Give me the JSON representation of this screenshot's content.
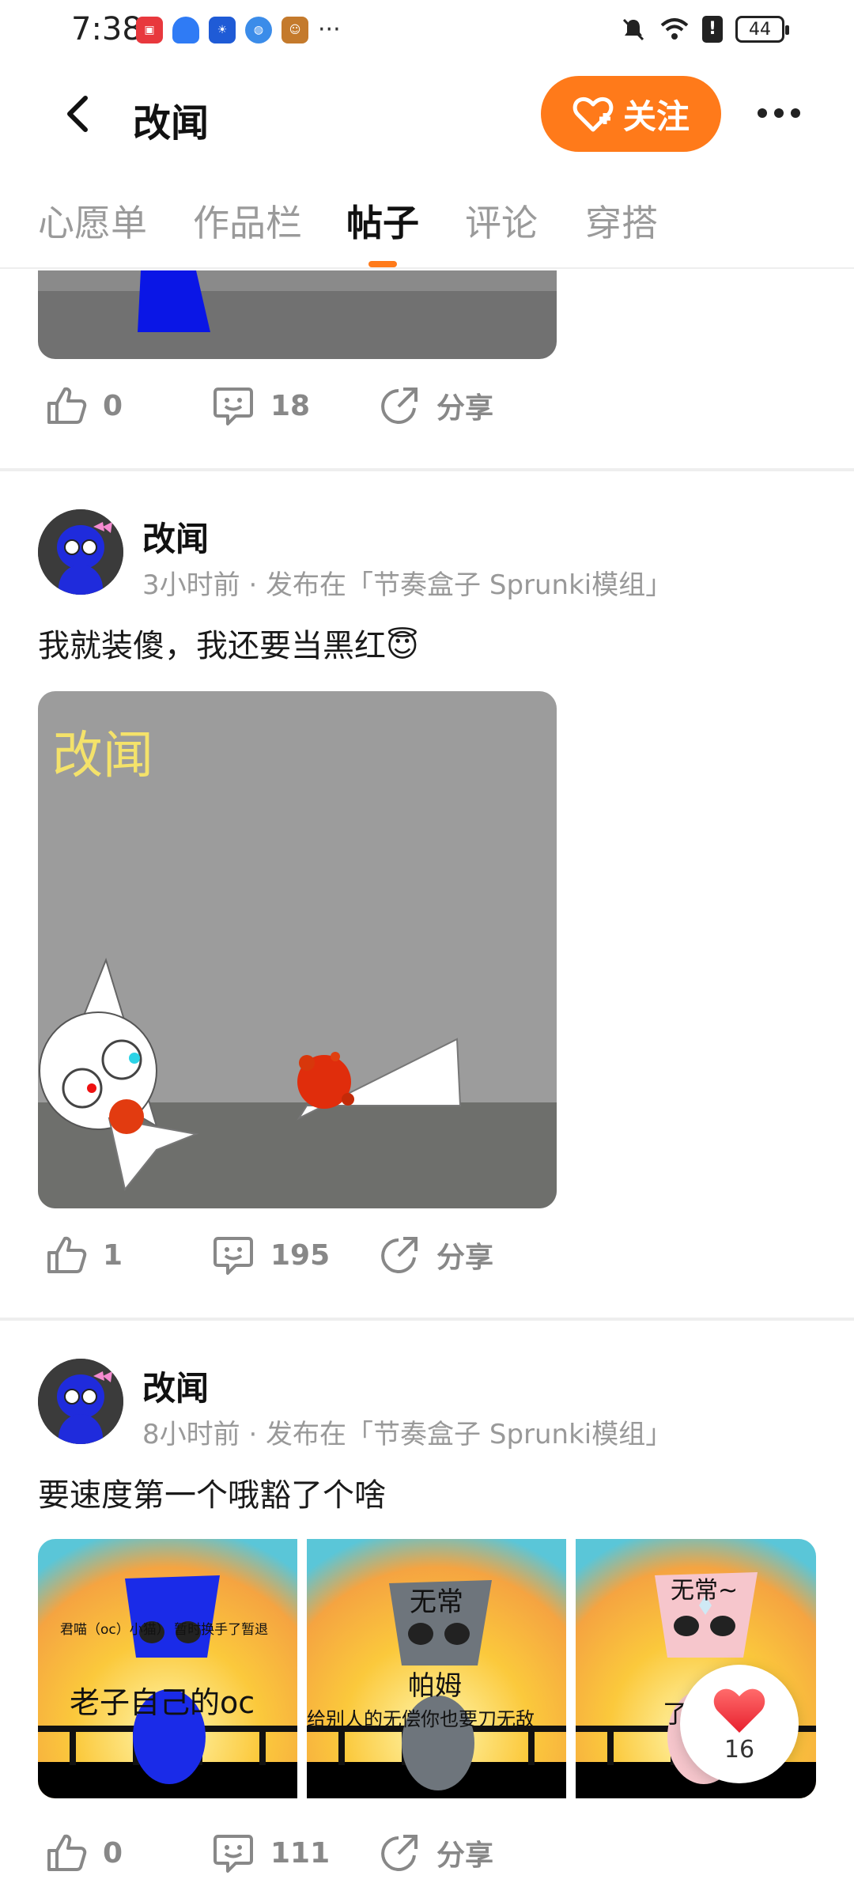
{
  "status_bar": {
    "time": "7:38",
    "battery": "44"
  },
  "header": {
    "title": "改闻",
    "follow_label": "关注"
  },
  "tabs": [
    {
      "label": "心愿单"
    },
    {
      "label": "作品栏"
    },
    {
      "label": "帖子",
      "active": true
    },
    {
      "label": "评论"
    },
    {
      "label": "穿搭"
    }
  ],
  "posts": [
    {
      "likes": "0",
      "comments": "18",
      "share_label": "分享"
    },
    {
      "author": "改闻",
      "meta": "3小时前 · 发布在「节奏盒子 Sprunki模组」",
      "text": "我就装傻，我还要当黑红😇",
      "image_caption": "改闻",
      "likes": "1",
      "comments": "195",
      "share_label": "分享"
    },
    {
      "author": "改闻",
      "meta": "8小时前 · 发布在「节奏盒子 Sprunki模组」",
      "text": "要速度第一个哦豁了个啥",
      "images": [
        {
          "top_text": "君喵（oc）小猫） 暂时换手了暂退",
          "bottom_text": "老子自己的oc"
        },
        {
          "top_text": "无常",
          "middle_text": "帕姆",
          "bottom_text": "给别人的无偿你也要刀无敌"
        },
        {
          "top_text": "无常~",
          "bottom_text": "了"
        }
      ],
      "likes": "0",
      "comments": "111",
      "share_label": "分享"
    }
  ],
  "floating_like": {
    "count": "16"
  },
  "colors": {
    "accent": "#ff7a1a",
    "divider": "#eeeeee",
    "muted_text": "#999999"
  }
}
